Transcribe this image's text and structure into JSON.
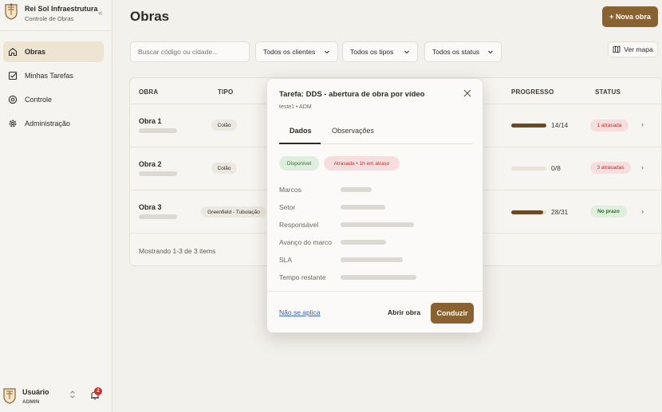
{
  "brand": {
    "name": "Rei Sol Infraestrutura",
    "subtitle": "Controle de Obras",
    "collapse_glyph": "«"
  },
  "sidebar": {
    "items": [
      {
        "label": "Obras",
        "icon": "home-icon"
      },
      {
        "label": "Minhas Tarefas",
        "icon": "task-check-icon"
      },
      {
        "label": "Controle",
        "icon": "target-icon"
      },
      {
        "label": "Administração",
        "icon": "gear-icon"
      }
    ]
  },
  "user": {
    "name": "Usuário",
    "role": "ADMIN",
    "toggle_glyph": "⌃⌄",
    "notifications": "2"
  },
  "header": {
    "title": "Obras",
    "new_button": "+ Nova obra"
  },
  "filters": {
    "search_placeholder": "Buscar código ou cidade...",
    "clients": "Todos os clientes",
    "types": "Todos os tipos",
    "status": "Todos os status",
    "map_button": "Ver mapa"
  },
  "table": {
    "headers": {
      "obra": "OBRA",
      "tipo": "TIPO",
      "progresso": "PROGRESSO",
      "status": "STATUS"
    },
    "rows": [
      {
        "name": "Obra 1",
        "type": "Colão",
        "progress_text": "14/14",
        "progress": 1.0,
        "status": "1 atrasada",
        "status_kind": "late"
      },
      {
        "name": "Obra 2",
        "type": "Colão",
        "progress_text": "0/8",
        "progress": 0.0,
        "status": "3 atrasadas",
        "status_kind": "late"
      },
      {
        "name": "Obra 3",
        "type": "Greenfield - Tubulação",
        "progress_text": "28/31",
        "progress": 0.9,
        "status": "No prazo",
        "status_kind": "ok"
      }
    ],
    "footer": "Mostrando 1-3 de 3 items"
  },
  "modal": {
    "title": "Tarefa: DDS - abertura de obra por vídeo",
    "subtitle": "teste1 • ADM",
    "tabs": [
      "Dados",
      "Observações"
    ],
    "chips": {
      "available": "Disponível",
      "late": "Atrasada • 1h em atraso"
    },
    "fields": [
      "Marcos",
      "Setor",
      "Responsável",
      "Avanço do marco",
      "SLA",
      "Tempo restante"
    ],
    "not_applicable": "Não se aplica",
    "open_button": "Abrir obra",
    "primary_button": "Conduzir"
  },
  "colors": {
    "accent": "#8a6232",
    "late_bg": "#f6dede",
    "late_fg": "#b3322c",
    "ok_bg": "#dfeedd",
    "ok_fg": "#2f6a34"
  }
}
